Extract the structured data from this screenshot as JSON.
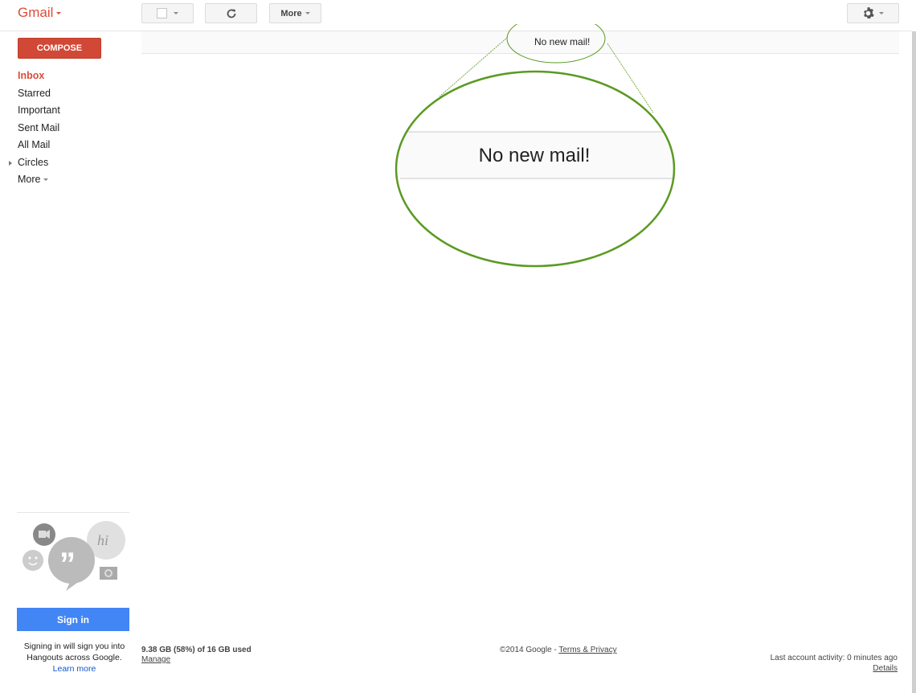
{
  "app": {
    "logo": "Gmail"
  },
  "toolbar": {
    "select_icon": "checkbox-icon",
    "refresh_icon": "refresh-icon",
    "more_label": "More",
    "settings_icon": "gear-icon"
  },
  "sidebar": {
    "compose_label": "COMPOSE",
    "items": [
      {
        "label": "Inbox",
        "active": true
      },
      {
        "label": "Starred"
      },
      {
        "label": "Important"
      },
      {
        "label": "Sent Mail"
      },
      {
        "label": "All Mail"
      },
      {
        "label": "Circles",
        "expandable": true
      },
      {
        "label": "More"
      }
    ],
    "hangouts": {
      "illustration": "hangouts-icon",
      "sign_in_label": "Sign in",
      "hint_line1": "Signing in will sign you into",
      "hint_line2": "Hangouts across Google.",
      "learn_more": "Learn more"
    }
  },
  "main": {
    "status_message": "No new mail!",
    "magnified_message": "No new mail!",
    "annotation_color": "#5a9a22"
  },
  "footer": {
    "storage": "9.38 GB (58%) of 16 GB used",
    "storage_used_percent": 58,
    "manage": "Manage",
    "copyright": "©2014 Google - ",
    "terms": "Terms & Privacy",
    "last_activity": "Last account activity: 0 minutes ago",
    "details": "Details"
  }
}
